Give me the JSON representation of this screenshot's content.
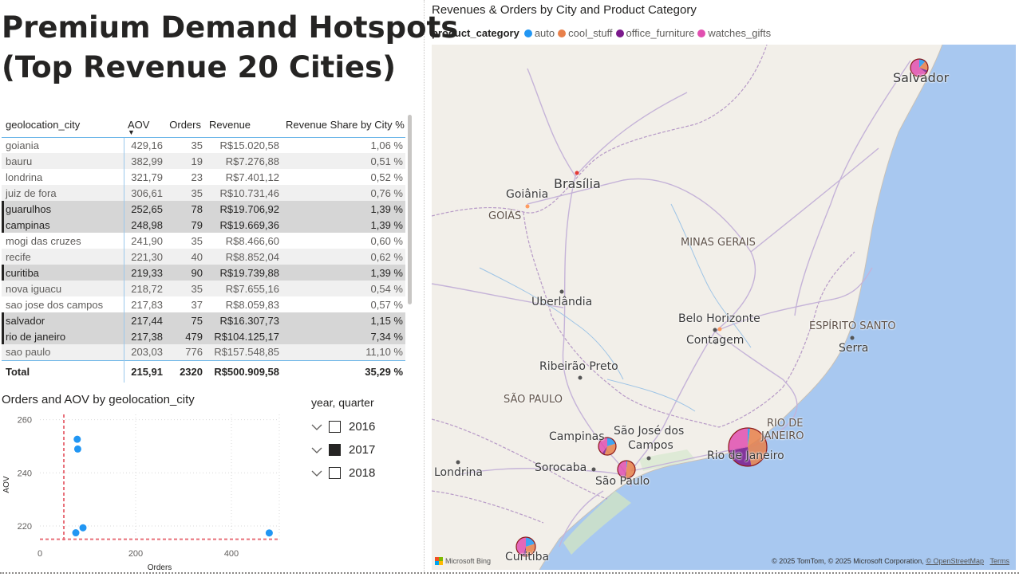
{
  "page": {
    "title_line1": "Premium Demand Hotspots",
    "title_line2": "(Top Revenue 20 Cities)"
  },
  "table": {
    "columns": [
      "geolocation_city",
      "AOV",
      "Orders",
      "Revenue",
      "Revenue Share by City %"
    ],
    "rows": [
      {
        "city": "goiania",
        "aov": "429,16",
        "orders": "35",
        "revenue": "R$15.020,58",
        "share": "1,06 %",
        "selected": false
      },
      {
        "city": "bauru",
        "aov": "382,99",
        "orders": "19",
        "revenue": "R$7.276,88",
        "share": "0,51 %",
        "selected": false
      },
      {
        "city": "londrina",
        "aov": "321,79",
        "orders": "23",
        "revenue": "R$7.401,12",
        "share": "0,52 %",
        "selected": false
      },
      {
        "city": "juiz de fora",
        "aov": "306,61",
        "orders": "35",
        "revenue": "R$10.731,46",
        "share": "0,76 %",
        "selected": false
      },
      {
        "city": "guarulhos",
        "aov": "252,65",
        "orders": "78",
        "revenue": "R$19.706,92",
        "share": "1,39 %",
        "selected": true
      },
      {
        "city": "campinas",
        "aov": "248,98",
        "orders": "79",
        "revenue": "R$19.669,36",
        "share": "1,39 %",
        "selected": true
      },
      {
        "city": "mogi das cruzes",
        "aov": "241,90",
        "orders": "35",
        "revenue": "R$8.466,60",
        "share": "0,60 %",
        "selected": false
      },
      {
        "city": "recife",
        "aov": "221,30",
        "orders": "40",
        "revenue": "R$8.852,04",
        "share": "0,62 %",
        "selected": false
      },
      {
        "city": "curitiba",
        "aov": "219,33",
        "orders": "90",
        "revenue": "R$19.739,88",
        "share": "1,39 %",
        "selected": true
      },
      {
        "city": "nova iguacu",
        "aov": "218,72",
        "orders": "35",
        "revenue": "R$7.655,16",
        "share": "0,54 %",
        "selected": false
      },
      {
        "city": "sao jose dos campos",
        "aov": "217,83",
        "orders": "37",
        "revenue": "R$8.059,83",
        "share": "0,57 %",
        "selected": false
      },
      {
        "city": "salvador",
        "aov": "217,44",
        "orders": "75",
        "revenue": "R$16.307,73",
        "share": "1,15 %",
        "selected": true
      },
      {
        "city": "rio de janeiro",
        "aov": "217,38",
        "orders": "479",
        "revenue": "R$104.125,17",
        "share": "7,34 %",
        "selected": true
      },
      {
        "city": "sao paulo",
        "aov": "203,03",
        "orders": "776",
        "revenue": "R$157.548,85",
        "share": "11,10 %",
        "selected": false
      }
    ],
    "total": {
      "label": "Total",
      "aov": "215,91",
      "orders": "2320",
      "revenue": "R$500.909,58",
      "share": "35,29 %"
    }
  },
  "scatter": {
    "title": "Orders and AOV by geolocation_city",
    "xlabel": "Orders",
    "ylabel": "AOV",
    "point_color": "#2196f3",
    "refline_color": "#e8707a"
  },
  "chart_data": {
    "type": "scatter",
    "title": "Orders and AOV by geolocation_city",
    "xlabel": "Orders",
    "ylabel": "AOV",
    "xlim": [
      0,
      500
    ],
    "ylim": [
      214,
      262
    ],
    "x_ticks": [
      0,
      200,
      400
    ],
    "y_ticks": [
      220,
      240,
      260
    ],
    "grid": true,
    "points": [
      {
        "x": 78,
        "y": 252.65
      },
      {
        "x": 79,
        "y": 248.98
      },
      {
        "x": 90,
        "y": 219.33
      },
      {
        "x": 75,
        "y": 217.44
      },
      {
        "x": 479,
        "y": 217.38
      }
    ],
    "reference_lines": {
      "x": 50,
      "y": 215
    }
  },
  "slicer": {
    "title": "year, quarter",
    "items": [
      {
        "label": "2016",
        "checked": false
      },
      {
        "label": "2017",
        "checked": true
      },
      {
        "label": "2018",
        "checked": false
      }
    ]
  },
  "map": {
    "title": "Revenues & Orders by City and Product Category",
    "legend_title": "product_category",
    "legend": [
      {
        "label": "auto",
        "color": "#2196f3"
      },
      {
        "label": "cool_stuff",
        "color": "#e8804a"
      },
      {
        "label": "office_furniture",
        "color": "#7b1a8c"
      },
      {
        "label": "watches_gifts",
        "color": "#e14fb0"
      }
    ],
    "labels": {
      "salvador": "Salvador",
      "brasilia": "Brasília",
      "goiania": "Goiânia",
      "goias": "GOIÁS",
      "minas": "MINAS GERAIS",
      "uberlandia": "Uberlândia",
      "bh": "Belo Horizonte",
      "contagem": "Contagem",
      "es": "ESPÍRITO SANTO",
      "serra": "Serra",
      "ribeirao": "Ribeirão Preto",
      "sp_state": "SÃO PAULO",
      "rj_state1": "RIO DE",
      "rj_state2": "JANEIRO",
      "campinas": "Campinas",
      "sjc1": "São José dos",
      "sjc2": "Campos",
      "rio": "Rio de Janeiro",
      "londrina": "Londrina",
      "sorocaba": "Sorocaba",
      "sp": "São Paulo",
      "curitiba": "Curitiba"
    },
    "bing": "Microsoft Bing",
    "copyright": "© 2025 TomTom, © 2025 Microsoft Corporation,",
    "osm": "© OpenStreetMap",
    "terms": "Terms"
  }
}
